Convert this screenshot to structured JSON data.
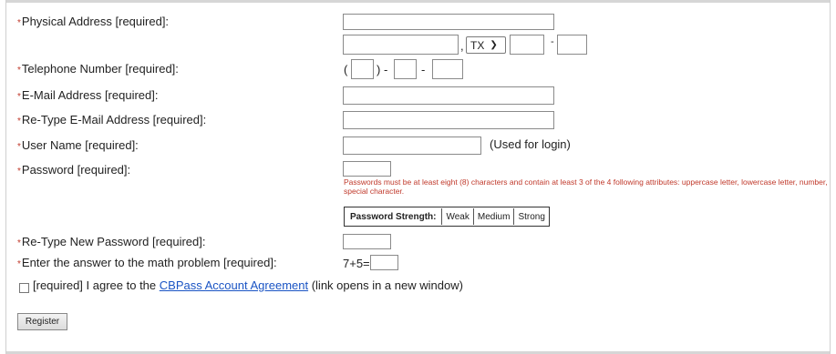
{
  "form": {
    "required_marker": "*",
    "physical_address": {
      "label": "Physical Address [required]:",
      "comma": ",",
      "state": "TX",
      "dash": "-"
    },
    "telephone": {
      "label": "Telephone Number [required]:",
      "open_paren": "(",
      "close_dash": ") -",
      "dash": "-"
    },
    "email": {
      "label": "E-Mail Address [required]:"
    },
    "email_confirm": {
      "label": "Re-Type E-Mail Address [required]:"
    },
    "username": {
      "label": "User Name [required]:",
      "hint": "(Used for login)"
    },
    "password": {
      "label": "Password [required]:",
      "help": "Passwords must be at least eight (8) characters and contain at least 3 of the 4 following attributes: uppercase letter, lowercase letter, number, special character.",
      "strength_label": "Password Strength:",
      "strength_levels": [
        "Weak",
        "Medium",
        "Strong"
      ]
    },
    "password_confirm": {
      "label": "Re-Type New Password [required]:"
    },
    "math": {
      "label": "Enter the answer to the math problem [required]:",
      "problem": "7+5="
    },
    "agreement": {
      "prefix": "[required] I agree to the",
      "link_text": "CBPass Account Agreement",
      "suffix": "(link opens in a new window)"
    },
    "register_button": "Register"
  },
  "colors": {
    "required": "#c0392b",
    "link": "#1a54c4"
  }
}
